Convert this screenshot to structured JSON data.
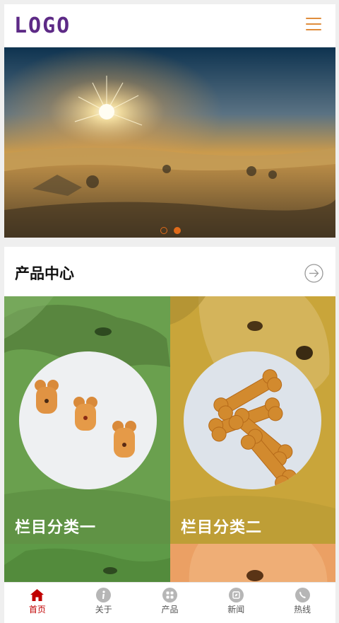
{
  "header": {
    "logo_text": "LOGO",
    "menu_icon": "hamburger-menu-icon"
  },
  "banner": {
    "slide_count": 2,
    "active_slide": 2,
    "colors": {
      "dot": "#e06a1a"
    }
  },
  "section": {
    "title": "产品中心",
    "more_icon": "arrow-right-circle-icon"
  },
  "categories": [
    {
      "label": "栏目分类一",
      "color": "#6aa04e"
    },
    {
      "label": "栏目分类二",
      "color": "#c9a53a"
    }
  ],
  "tabbar": {
    "items": [
      {
        "label": "首页",
        "icon": "home-icon",
        "active": true
      },
      {
        "label": "关于",
        "icon": "info-icon",
        "active": false
      },
      {
        "label": "产品",
        "icon": "grid-icon",
        "active": false
      },
      {
        "label": "新闻",
        "icon": "compass-icon",
        "active": false
      },
      {
        "label": "热线",
        "icon": "phone-icon",
        "active": false
      }
    ],
    "active_color": "#c00000"
  }
}
